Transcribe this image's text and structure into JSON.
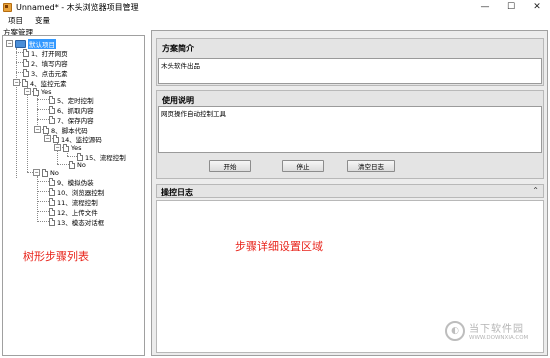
{
  "window": {
    "title": "Unnamed* - 木头浏览器项目管理",
    "controls": {
      "minimize": "—",
      "maximize": "☐",
      "close": "✕"
    }
  },
  "menu": {
    "items": [
      "项目",
      "变量"
    ]
  },
  "left": {
    "header": "方案管理",
    "annotation": "树形步骤列表"
  },
  "tree": {
    "root": "默认项目",
    "n1": "1、打开网页",
    "n2": "2、填写内容",
    "n3": "3、点击元素",
    "n4": "4、监控元素",
    "yes1": "Yes",
    "n5": "5、定时控制",
    "n6": "6、抓取内容",
    "n7": "7、保存内容",
    "n8": "8、脚本代码",
    "n14": "14、监控源码",
    "yes2": "Yes",
    "n15": "15、流程控制",
    "no2": "No",
    "no1": "No",
    "n9": "9、模拟伪装",
    "n10": "10、浏览器控制",
    "n11": "11、流程控制",
    "n12": "12、上传文件",
    "n13": "13、模态对话框",
    "toggle_minus": "−"
  },
  "right": {
    "annotation": "步骤详细设置区域",
    "intro_title": "方案简介",
    "intro_value": "木头软件出品",
    "usage_title": "使用说明",
    "usage_value": "网页操作自动控制工具",
    "buttons": {
      "start": "开始",
      "stop": "停止",
      "clear_log": "清空日志"
    },
    "log_title": "操控日志",
    "collapse_glyph": "⌃"
  },
  "watermark": {
    "text": "当下软件园",
    "url": "WWW.DOWNXIA.COM",
    "glyph": "◐"
  }
}
